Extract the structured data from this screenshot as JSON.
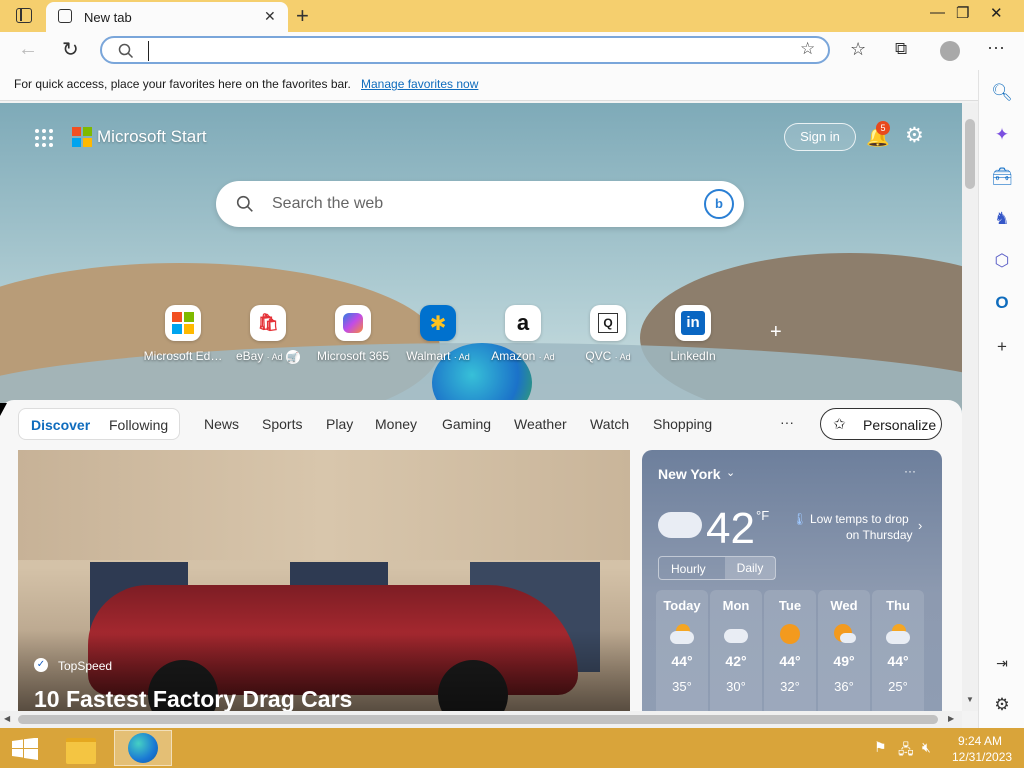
{
  "browser": {
    "tab_title": "New tab",
    "address_value": "",
    "favorites_message": "For quick access, place your favorites here on the favorites bar.",
    "favorites_link": "Manage favorites now",
    "colors": {
      "titlebar": "#f5cf6e",
      "accent": "#0f6cbd"
    }
  },
  "header": {
    "brand": "Microsoft Start",
    "sign_in": "Sign in",
    "notifications_count": "5"
  },
  "search": {
    "placeholder": "Search the web"
  },
  "quick_links": [
    {
      "label": "Microsoft Ed…",
      "ad": ""
    },
    {
      "label": "eBay",
      "ad": "· Ad"
    },
    {
      "label": "Microsoft 365",
      "ad": ""
    },
    {
      "label": "Walmart",
      "ad": "· Ad"
    },
    {
      "label": "Amazon",
      "ad": "· Ad"
    },
    {
      "label": "QVC",
      "ad": "· Ad"
    },
    {
      "label": "LinkedIn",
      "ad": ""
    }
  ],
  "feed_tabs": {
    "discover": "Discover",
    "following": "Following",
    "categories": [
      "News",
      "Sports",
      "Play",
      "Money",
      "Gaming",
      "Weather",
      "Watch",
      "Shopping"
    ],
    "more": "···",
    "personalize": "Personalize"
  },
  "hero": {
    "source": "TopSpeed",
    "headline": "10 Fastest Factory Drag Cars"
  },
  "weather": {
    "location": "New York",
    "temp": "42",
    "unit": "°F",
    "alert_line1": "Low temps to drop",
    "alert_line2": "on Thursday",
    "toggle_hourly": "Hourly",
    "toggle_daily": "Daily",
    "more": "···",
    "days": [
      {
        "name": "Today",
        "hi": "44°",
        "lo": "35°",
        "icon": "partly-cloudy-icon"
      },
      {
        "name": "Mon",
        "hi": "42°",
        "lo": "30°",
        "icon": "cloudy-icon"
      },
      {
        "name": "Tue",
        "hi": "44°",
        "lo": "32°",
        "icon": "sunny-icon"
      },
      {
        "name": "Wed",
        "hi": "49°",
        "lo": "36°",
        "icon": "partly-sunny-icon"
      },
      {
        "name": "Thu",
        "hi": "44°",
        "lo": "25°",
        "icon": "partly-cloudy-icon"
      }
    ]
  },
  "taskbar": {
    "time": "9:24 AM",
    "date": "12/31/2023"
  }
}
